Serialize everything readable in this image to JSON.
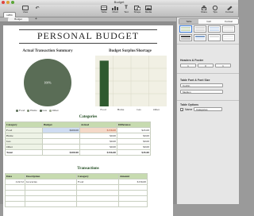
{
  "window": {
    "title": "Budget"
  },
  "toolbar": {
    "view_label": "View",
    "zoom_label": "Zoom",
    "zoom_value": "125%",
    "items": [
      {
        "name": "table",
        "label": "Table"
      },
      {
        "name": "chart",
        "label": "Chart"
      },
      {
        "name": "text",
        "label": "Text"
      },
      {
        "name": "shape",
        "label": "Shape"
      },
      {
        "name": "media",
        "label": "Media"
      }
    ],
    "right_items": [
      {
        "name": "share",
        "label": "Share"
      },
      {
        "name": "tips",
        "label": "Tips"
      },
      {
        "name": "format",
        "label": "Format"
      }
    ]
  },
  "tabs": [
    {
      "label": "Budget"
    }
  ],
  "document": {
    "title": "PERSONAL BUDGET",
    "pie_chart": {
      "title": "Actual Transaction Summary",
      "label": "100%",
      "legend": [
        "Food",
        "Home",
        "Gas",
        "Other"
      ]
    },
    "bar_chart": {
      "title": "Budget Surplus/Shortage",
      "categories": [
        "Food",
        "Home",
        "Gas",
        "Other"
      ]
    },
    "categories_table": {
      "title": "Categories",
      "headers": [
        "Category",
        "Budget",
        "Actual",
        "Difference"
      ],
      "rows": [
        [
          "Food",
          "$200.00",
          "$156.00",
          "$45.00"
        ],
        [
          "Home",
          "",
          "$0.00",
          "$0.00"
        ],
        [
          "Gas",
          "",
          "$0.00",
          "$0.00"
        ],
        [
          "Other",
          "",
          "$0.00",
          "$0.00"
        ],
        [
          "Total",
          "$200.00",
          "$156.00",
          "$45.00"
        ]
      ]
    },
    "transactions_table": {
      "title": "Transactions",
      "headers": [
        "Date",
        "Description",
        "Category",
        "Amount"
      ],
      "rows": [
        [
          "1/22/12",
          "Groceries",
          "Food",
          "$156.00"
        ]
      ]
    }
  },
  "inspector": {
    "tabs": [
      "Table",
      "Cell",
      "Format"
    ],
    "selected_tab": "Table",
    "headers_footer_label": "Headers & Footer",
    "header_values": [
      "1",
      "0",
      "1"
    ],
    "table_font_label": "Table Font & Font Size",
    "font_value": "Cochin",
    "font_style_value": "Medium",
    "table_options_label": "Table Options",
    "name_checkbox_label": "Name",
    "name_value": "Categories",
    "name_checked": true
  },
  "chart_data": [
    {
      "type": "pie",
      "title": "Actual Transaction Summary",
      "categories": [
        "Food",
        "Home",
        "Gas",
        "Other"
      ],
      "values": [
        100,
        0,
        0,
        0
      ],
      "data_labels": [
        "100%"
      ],
      "legend": "bottom"
    },
    {
      "type": "bar",
      "title": "Budget Surplus/Shortage",
      "categories": [
        "Food",
        "Home",
        "Gas",
        "Other"
      ],
      "values": [
        45,
        0,
        0,
        0
      ],
      "ylim": [
        0,
        50
      ],
      "grid": true
    }
  ],
  "colors": {
    "accent": "#3b7bd8",
    "pie_fill": "#5a6d56",
    "bar_fill": "#2f5a2f",
    "header_green": "#c7dbb0"
  }
}
